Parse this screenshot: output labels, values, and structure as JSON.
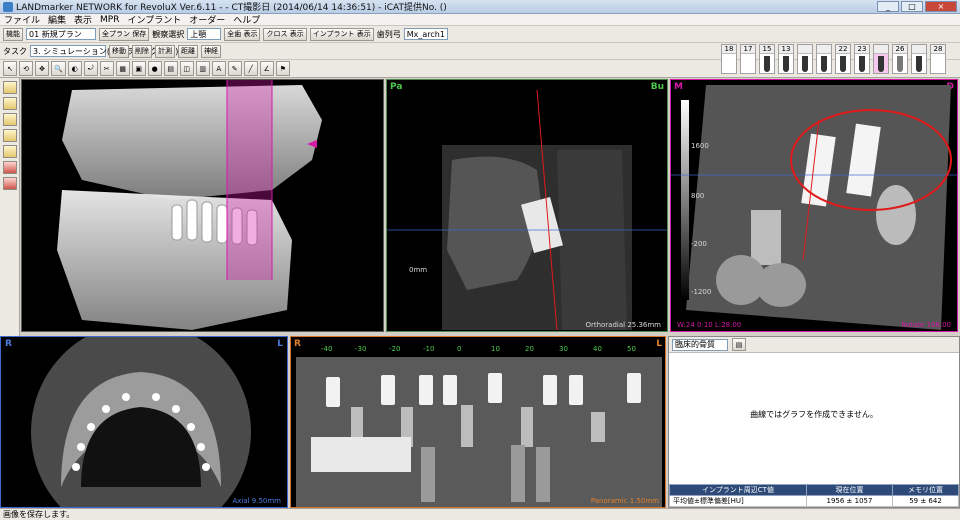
{
  "window": {
    "title": "LANDmarker NETWORK for RevoluX Ver.6.11 -                    - CT撮影日 (2014/06/14 14:36:51)  - iCAT提供No. ()",
    "minimize": "_",
    "maximize": "□",
    "close": "×"
  },
  "menu": [
    "ファイル",
    "編集",
    "表示",
    "MPR",
    "インプラント",
    "オーダー",
    "ヘルプ"
  ],
  "toolbar1": {
    "icon_label": "機能",
    "plan_select": "01 新規プラン",
    "btn_plan_save": "全プラン 保存",
    "view_select_label": "観察選択",
    "view_select": "上顎",
    "btn_all_teeth": "全歯 表示",
    "btn_cross": "クロス 表示",
    "btn_implant": "インプラント 表示",
    "arch_label": "歯列弓",
    "arch_select": "Mx_arch1"
  },
  "toolbar2": {
    "task_label": "タスク",
    "task_select": "3. シミュレーション(パノラミックMPR)",
    "btn_move": "移動",
    "btn_delete": "削除",
    "btn_measure": "計測",
    "btn_distance": "距離",
    "btn_nerve": "神経"
  },
  "teeth": [
    {
      "num": "18",
      "type": "none"
    },
    {
      "num": "17",
      "type": "none"
    },
    {
      "num": "15",
      "type": "tooth"
    },
    {
      "num": "13",
      "type": "tooth"
    },
    {
      "num": "",
      "type": "tooth"
    },
    {
      "num": "",
      "type": "tooth"
    },
    {
      "num": "22",
      "type": "tooth"
    },
    {
      "num": "23",
      "type": "tooth"
    },
    {
      "num": "",
      "type": "selected"
    },
    {
      "num": "26",
      "type": "implant"
    },
    {
      "num": "",
      "type": "tooth"
    },
    {
      "num": "28",
      "type": "none"
    }
  ],
  "panels": {
    "volume": {
      "name": "3D"
    },
    "cross": {
      "top_left": "Pa",
      "top_right": "Bu",
      "mid_left": "0mm",
      "footer": "Orthoradial 25.36mm"
    },
    "axial_slice": {
      "top_left": "M",
      "top_right": "D",
      "scale": [
        "1600",
        "800",
        "-200",
        "-1200"
      ],
      "footer_left": "W:24  0:10 L:28.00",
      "footer_right": "Rotate 108.00"
    },
    "axial": {
      "top_left": "R",
      "top_right": "L",
      "footer": "Axial 9.50mm"
    },
    "panoramic": {
      "top_left": "R",
      "top_right": "L",
      "ticks": [
        "-40",
        "-30",
        "-20",
        "-10",
        "0",
        "10",
        "20",
        "30",
        "40",
        "50"
      ],
      "footer": "Panoramic 1.50mm"
    }
  },
  "info_panel": {
    "select": "臨床的骨質",
    "message": "曲線ではグラフを作成できません。",
    "headers": [
      "インプラント周辺CT値",
      "現在位置",
      "メモリ位置"
    ],
    "row": {
      "label": "平均値±標準偏差[HU]",
      "current": "1956 ± 1057",
      "memory": "59 ± 642"
    }
  },
  "status": "画像を保存します。",
  "colors": {
    "accent_magenta": "#d51aa8",
    "annotation_red": "#e01a1a"
  }
}
